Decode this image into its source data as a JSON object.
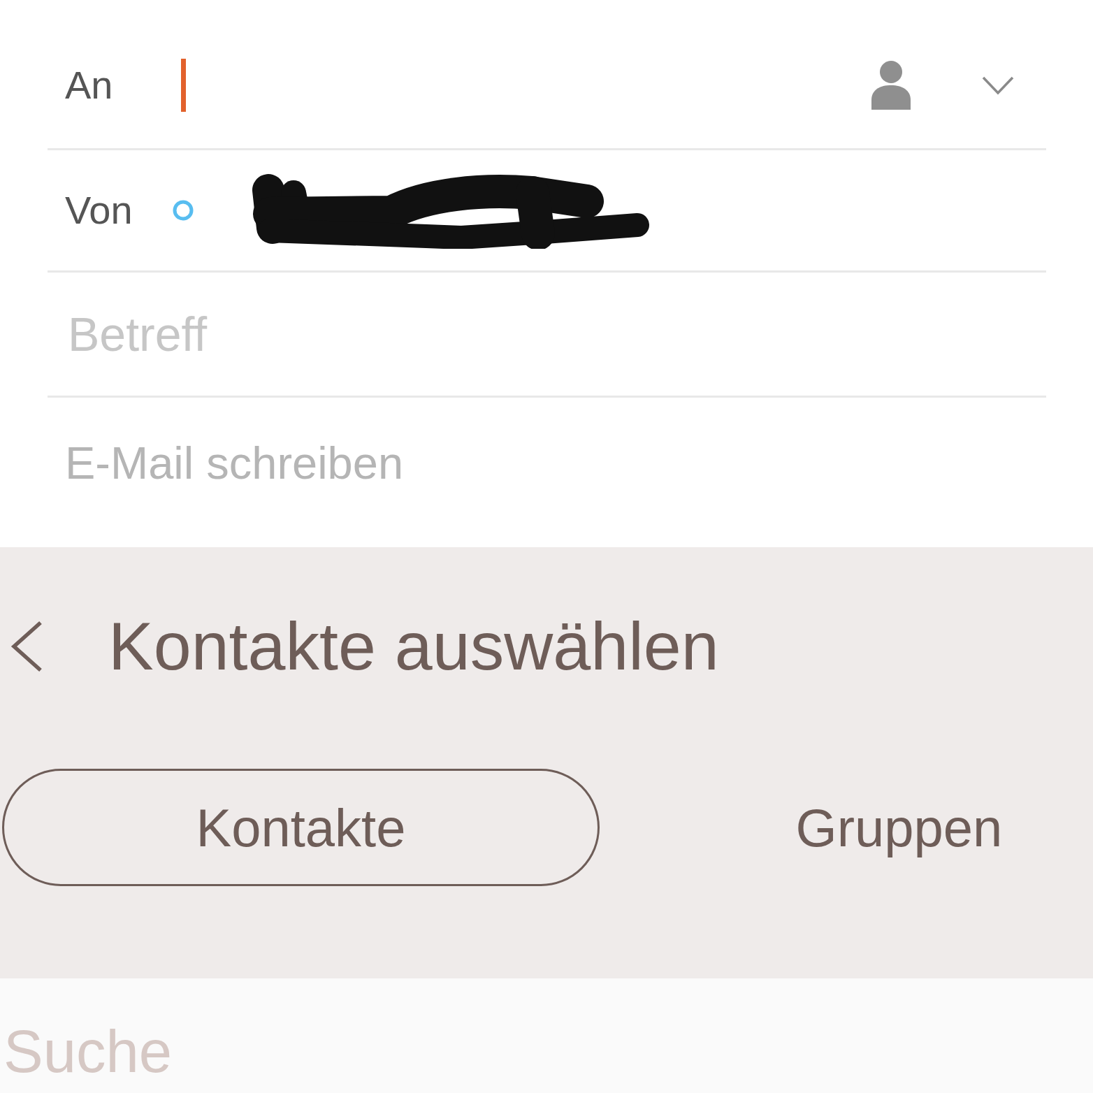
{
  "compose": {
    "to": {
      "label": "An",
      "focused": true
    },
    "from": {
      "label": "Von",
      "redacted": true
    },
    "subject": {
      "placeholder": "Betreff"
    },
    "body": {
      "placeholder": "E-Mail schreiben"
    }
  },
  "contact_picker": {
    "title": "Kontakte auswählen",
    "tabs": [
      {
        "label": "Kontakte",
        "selected": true
      },
      {
        "label": "Gruppen",
        "selected": false
      }
    ],
    "search": {
      "placeholder": "Suche"
    }
  }
}
